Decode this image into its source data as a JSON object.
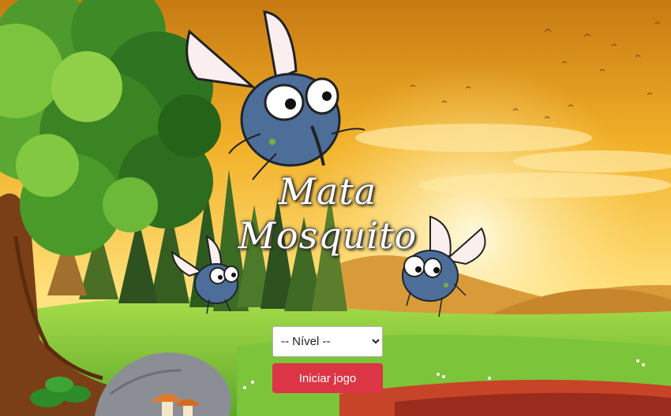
{
  "game": {
    "title_line1": "Mata",
    "title_line2": "Mosquito"
  },
  "level_select": {
    "selected": "-- Nível --",
    "options": [
      "-- Nível --"
    ]
  },
  "start_button": {
    "label": "Iniciar jogo"
  },
  "colors": {
    "sky_top": "#d9901c",
    "sky_bottom": "#ffe27a",
    "grass": "#8ed43a",
    "button": "#dc3545",
    "fly_body": "#4d6e99"
  },
  "icons": [
    "fly-icon",
    "tree-icon",
    "rock-icon",
    "mushroom-icon"
  ]
}
